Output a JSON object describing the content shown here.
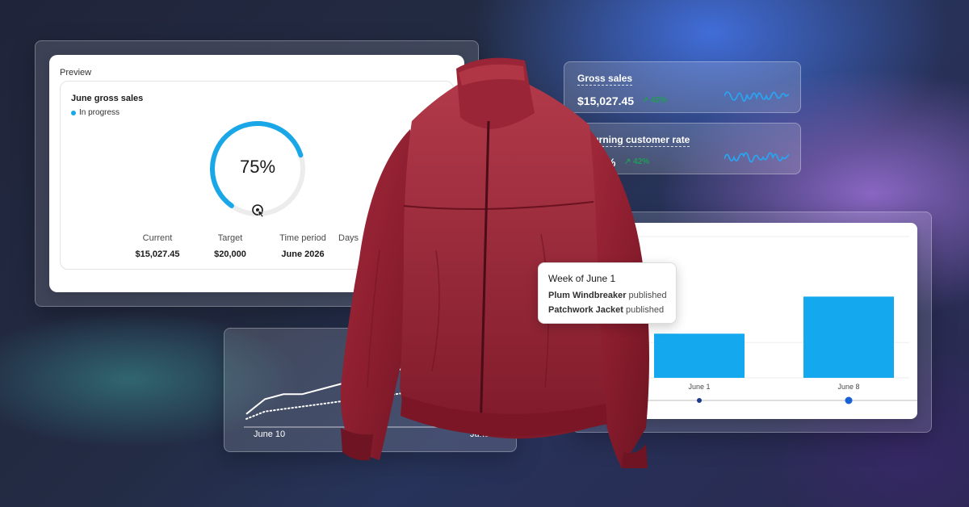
{
  "preview": {
    "label": "Preview",
    "title": "June gross sales",
    "status": "In progress",
    "gauge_value": "75%",
    "gauge_fraction": 0.75,
    "metrics": [
      {
        "label": "Current",
        "value": "$15,027.45"
      },
      {
        "label": "Target",
        "value": "$20,000"
      },
      {
        "label": "Time period",
        "value": "June 2026"
      },
      {
        "label": "Days",
        "value": ""
      }
    ]
  },
  "kpis": [
    {
      "title": "Gross sales",
      "value": "$15,027.45",
      "change": "↗ 42%"
    },
    {
      "title": "Returning customer rate",
      "value": "37.52%",
      "change": "↗ 42%"
    }
  ],
  "tooltip": {
    "title": "Week of June 1",
    "lines": [
      {
        "name": "Plum Windbreaker",
        "suffix": "published"
      },
      {
        "name": "Patchwork Jacket",
        "suffix": "published"
      }
    ]
  },
  "line_chart": {
    "x_start": "June 10",
    "x_end": "June 16"
  },
  "colors": {
    "accent": "#1aa7e8",
    "positive": "#1f9d55",
    "bar": "#14a9ee",
    "slider_dot": "#1760d6"
  },
  "chart_data": [
    {
      "type": "bar",
      "categories": [
        "June 1",
        "June 8"
      ],
      "values": [
        12500,
        23000
      ],
      "ylim": [
        0,
        40000
      ],
      "ytick_labels": [
        "$40K",
        "$10K",
        "$0"
      ],
      "ytick_values": [
        40000,
        10000,
        0
      ],
      "grid": true
    },
    {
      "type": "line",
      "x_labels": [
        "June 10",
        "June 16"
      ],
      "series": [
        {
          "style": "solid",
          "values": [
            2,
            5,
            6,
            6,
            7,
            8,
            9,
            10,
            11,
            11,
            12,
            12.5,
            13,
            13.5,
            14
          ]
        },
        {
          "style": "dotted",
          "values": [
            1,
            2.5,
            3,
            3.5,
            4,
            4.5,
            5,
            5.5,
            6,
            6.5,
            7,
            7.5,
            8,
            8.5,
            9
          ]
        }
      ]
    }
  ]
}
